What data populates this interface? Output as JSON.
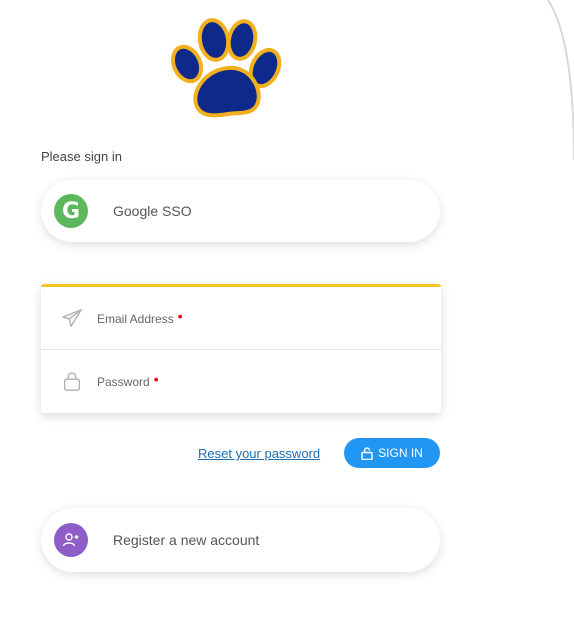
{
  "signin": {
    "prompt": "Please sign in",
    "google_sso_label": "Google SSO",
    "google_letter": "G",
    "email_label": "Email Address",
    "password_label": "Password",
    "required_mark": "•",
    "reset_link": "Reset your password",
    "signin_button": "SIGN IN",
    "register_label": "Register a new account"
  },
  "icons": {
    "logo": "paw-print-logo",
    "google": "google-icon",
    "email": "paper-plane-icon",
    "password": "lock-icon",
    "signin": "unlock-icon",
    "register": "add-user-icon"
  },
  "colors": {
    "accent_yellow": "#f5c425",
    "google_green": "#5cb85c",
    "register_purple": "#8e5dc8",
    "button_blue": "#2196f3",
    "link_blue": "#1a6fb5",
    "paw_navy": "#0d2a8a",
    "paw_gold": "#f2b01e",
    "required_red": "#e00000"
  }
}
